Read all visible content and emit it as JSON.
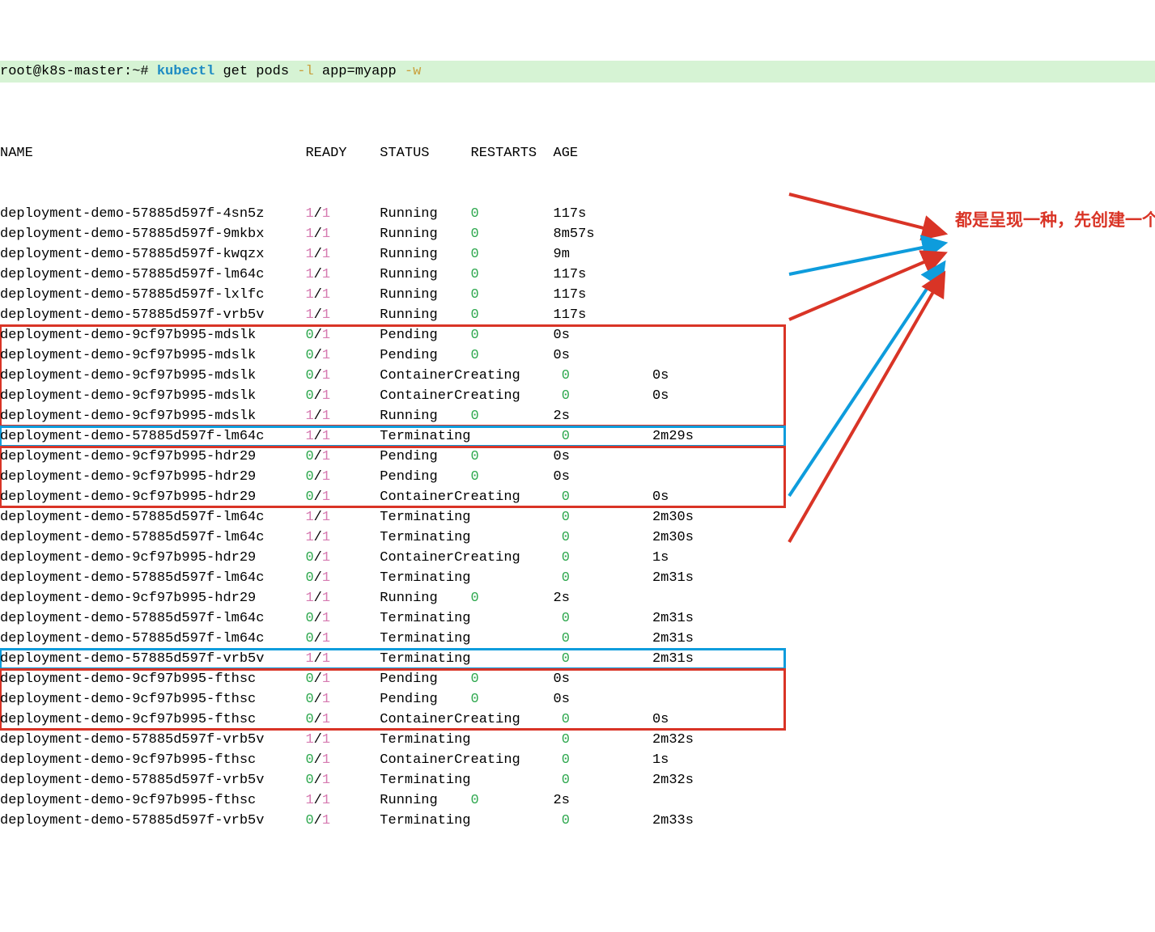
{
  "prompt": {
    "user_host": "root@k8s-master",
    "tilde": ":~#",
    "cmd": "kubectl",
    "rest": " get pods ",
    "flag1": "-l",
    "arg": " app=myapp ",
    "flag2": "-w"
  },
  "hdr": {
    "name": "NAME",
    "ready": "READY",
    "status": "STATUS",
    "restarts": "RESTARTS",
    "age": "AGE"
  },
  "rows": [
    {
      "n": "deployment-demo-57885d597f-4sn5z",
      "a": "1",
      "b": "1",
      "s": "Running",
      "r": "0",
      "g": "117s",
      "t": "A",
      "box": ""
    },
    {
      "n": "deployment-demo-57885d597f-9mkbx",
      "a": "1",
      "b": "1",
      "s": "Running",
      "r": "0",
      "g": "8m57s",
      "t": "A",
      "box": ""
    },
    {
      "n": "deployment-demo-57885d597f-kwqzx",
      "a": "1",
      "b": "1",
      "s": "Running",
      "r": "0",
      "g": "9m",
      "t": "A",
      "box": ""
    },
    {
      "n": "deployment-demo-57885d597f-lm64c",
      "a": "1",
      "b": "1",
      "s": "Running",
      "r": "0",
      "g": "117s",
      "t": "A",
      "box": ""
    },
    {
      "n": "deployment-demo-57885d597f-lxlfc",
      "a": "1",
      "b": "1",
      "s": "Running",
      "r": "0",
      "g": "117s",
      "t": "A",
      "box": ""
    },
    {
      "n": "deployment-demo-57885d597f-vrb5v",
      "a": "1",
      "b": "1",
      "s": "Running",
      "r": "0",
      "g": "117s",
      "t": "A",
      "box": ""
    },
    {
      "n": "deployment-demo-9cf97b995-mdslk",
      "a": "0",
      "b": "1",
      "s": "Pending",
      "r": "0",
      "g": "0s",
      "t": "B",
      "box": "red"
    },
    {
      "n": "deployment-demo-9cf97b995-mdslk",
      "a": "0",
      "b": "1",
      "s": "Pending",
      "r": "0",
      "g": "0s",
      "t": "B",
      "box": "red"
    },
    {
      "n": "deployment-demo-9cf97b995-mdslk",
      "a": "0",
      "b": "1",
      "s": "ContainerCreating",
      "r": "0",
      "g": "0s",
      "t": "C",
      "box": "red"
    },
    {
      "n": "deployment-demo-9cf97b995-mdslk",
      "a": "0",
      "b": "1",
      "s": "ContainerCreating",
      "r": "0",
      "g": "0s",
      "t": "C",
      "box": "red"
    },
    {
      "n": "deployment-demo-9cf97b995-mdslk",
      "a": "1",
      "b": "1",
      "s": "Running",
      "r": "0",
      "g": "2s",
      "t": "B",
      "box": "red"
    },
    {
      "n": "deployment-demo-57885d597f-lm64c",
      "a": "1",
      "b": "1",
      "s": "Terminating",
      "r": "0",
      "g": "2m29s",
      "t": "C",
      "box": "blue"
    },
    {
      "n": "deployment-demo-9cf97b995-hdr29",
      "a": "0",
      "b": "1",
      "s": "Pending",
      "r": "0",
      "g": "0s",
      "t": "B",
      "box": "red"
    },
    {
      "n": "deployment-demo-9cf97b995-hdr29",
      "a": "0",
      "b": "1",
      "s": "Pending",
      "r": "0",
      "g": "0s",
      "t": "B",
      "box": "red"
    },
    {
      "n": "deployment-demo-9cf97b995-hdr29",
      "a": "0",
      "b": "1",
      "s": "ContainerCreating",
      "r": "0",
      "g": "0s",
      "t": "C",
      "box": "red"
    },
    {
      "n": "deployment-demo-57885d597f-lm64c",
      "a": "1",
      "b": "1",
      "s": "Terminating",
      "r": "0",
      "g": "2m30s",
      "t": "C",
      "box": ""
    },
    {
      "n": "deployment-demo-57885d597f-lm64c",
      "a": "1",
      "b": "1",
      "s": "Terminating",
      "r": "0",
      "g": "2m30s",
      "t": "C",
      "box": ""
    },
    {
      "n": "deployment-demo-9cf97b995-hdr29",
      "a": "0",
      "b": "1",
      "s": "ContainerCreating",
      "r": "0",
      "g": "1s",
      "t": "C",
      "box": ""
    },
    {
      "n": "deployment-demo-57885d597f-lm64c",
      "a": "0",
      "b": "1",
      "s": "Terminating",
      "r": "0",
      "g": "2m31s",
      "t": "C",
      "box": ""
    },
    {
      "n": "deployment-demo-9cf97b995-hdr29",
      "a": "1",
      "b": "1",
      "s": "Running",
      "r": "0",
      "g": "2s",
      "t": "B",
      "box": ""
    },
    {
      "n": "deployment-demo-57885d597f-lm64c",
      "a": "0",
      "b": "1",
      "s": "Terminating",
      "r": "0",
      "g": "2m31s",
      "t": "C",
      "box": ""
    },
    {
      "n": "deployment-demo-57885d597f-lm64c",
      "a": "0",
      "b": "1",
      "s": "Terminating",
      "r": "0",
      "g": "2m31s",
      "t": "C",
      "box": ""
    },
    {
      "n": "deployment-demo-57885d597f-vrb5v",
      "a": "1",
      "b": "1",
      "s": "Terminating",
      "r": "0",
      "g": "2m31s",
      "t": "C",
      "box": "blue"
    },
    {
      "n": "deployment-demo-9cf97b995-fthsc",
      "a": "0",
      "b": "1",
      "s": "Pending",
      "r": "0",
      "g": "0s",
      "t": "B",
      "box": "red"
    },
    {
      "n": "deployment-demo-9cf97b995-fthsc",
      "a": "0",
      "b": "1",
      "s": "Pending",
      "r": "0",
      "g": "0s",
      "t": "B",
      "box": "red"
    },
    {
      "n": "deployment-demo-9cf97b995-fthsc",
      "a": "0",
      "b": "1",
      "s": "ContainerCreating",
      "r": "0",
      "g": "0s",
      "t": "C",
      "box": "red"
    },
    {
      "n": "deployment-demo-57885d597f-vrb5v",
      "a": "1",
      "b": "1",
      "s": "Terminating",
      "r": "0",
      "g": "2m32s",
      "t": "C",
      "box": ""
    },
    {
      "n": "deployment-demo-9cf97b995-fthsc",
      "a": "0",
      "b": "1",
      "s": "ContainerCreating",
      "r": "0",
      "g": "1s",
      "t": "C",
      "box": ""
    },
    {
      "n": "deployment-demo-57885d597f-vrb5v",
      "a": "0",
      "b": "1",
      "s": "Terminating",
      "r": "0",
      "g": "2m32s",
      "t": "C",
      "box": ""
    },
    {
      "n": "deployment-demo-9cf97b995-fthsc",
      "a": "1",
      "b": "1",
      "s": "Running",
      "r": "0",
      "g": "2s",
      "t": "B",
      "box": ""
    },
    {
      "n": "deployment-demo-57885d597f-vrb5v",
      "a": "0",
      "b": "1",
      "s": "Terminating",
      "r": "0",
      "g": "2m33s",
      "t": "C",
      "box": ""
    }
  ],
  "annotation": "都是呈现一种，先创建一个再删除一个，没有出现先创建两个，再删除两个。"
}
